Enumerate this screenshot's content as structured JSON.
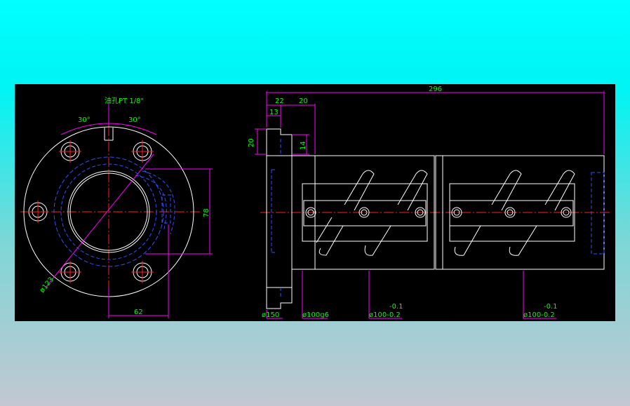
{
  "colors": {
    "background_top": "#00ffff",
    "background_bottom": "#c3c7d2",
    "canvas": "#000000",
    "outline": "#ffffff",
    "hidden_line": "#3050ff",
    "center_line": "#ff2020",
    "dimension_line": "#ff00ff",
    "dimension_text": "#00ff00"
  },
  "front_view": {
    "oil_hole_label": "油孔PT 1/8\"",
    "angle_left": "30°",
    "angle_right": "30°",
    "dim_height": "78",
    "dim_width": "62",
    "dim_bolt_circle": "ø123"
  },
  "side_view": {
    "dim_total_length": "296",
    "dim_flange_width": "22",
    "dim_shoulder": "20",
    "dim_hole_offset": "13",
    "dim_hole_pitch_left": "20",
    "dim_hole_pitch_right": "14",
    "dim_flange_dia": "ø150",
    "dim_spigot_dia": "ø100g6",
    "dim_body_dia_1_tol": "-0.1",
    "dim_body_dia_1": "ø100-0.2",
    "dim_body_dia_2_tol": "-0.1",
    "dim_body_dia_2": "ø100-0.2"
  }
}
